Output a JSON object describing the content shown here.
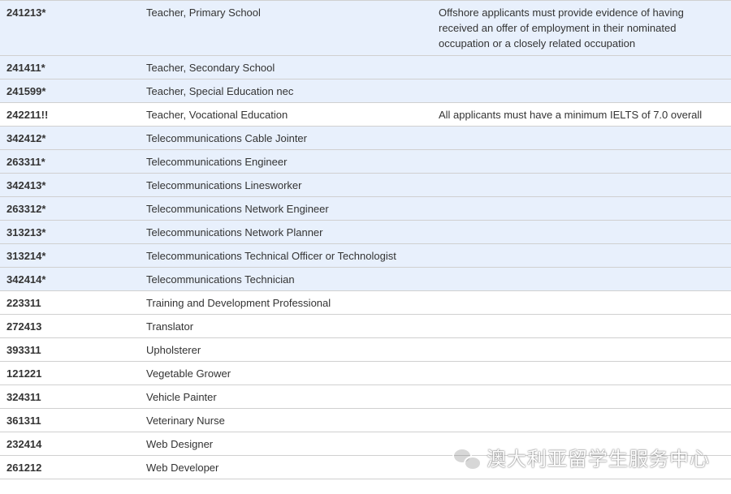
{
  "rows": [
    {
      "code": "241213*",
      "name": "Teacher, Primary School",
      "condition": "Offshore applicants must  provide evidence of having received an offer of employment in their nominated occupation or a closely related occupation",
      "shade": "blue"
    },
    {
      "code": "241411*",
      "name": "Teacher, Secondary School",
      "condition": "",
      "shade": "blue"
    },
    {
      "code": "241599*",
      "name": "Teacher, Special Education nec",
      "condition": "",
      "shade": "blue"
    },
    {
      "code": "242211!!",
      "name": "Teacher, Vocational Education",
      "condition": "All applicants must have a minimum IELTS of 7.0 overall",
      "shade": "white"
    },
    {
      "code": "342412*",
      "name": "Telecommunications Cable Jointer",
      "condition": "",
      "shade": "blue"
    },
    {
      "code": "263311*",
      "name": "Telecommunications Engineer",
      "condition": "",
      "shade": "blue"
    },
    {
      "code": "342413*",
      "name": "Telecommunications Linesworker",
      "condition": "",
      "shade": "blue"
    },
    {
      "code": "263312*",
      "name": "Telecommunications Network Engineer",
      "condition": "",
      "shade": "blue"
    },
    {
      "code": "313213*",
      "name": "Telecommunications Network Planner",
      "condition": "",
      "shade": "blue"
    },
    {
      "code": "313214*",
      "name": "Telecommunications Technical Officer or Technologist",
      "condition": "",
      "shade": "blue"
    },
    {
      "code": "342414*",
      "name": "Telecommunications Technician",
      "condition": "",
      "shade": "blue"
    },
    {
      "code": "223311",
      "name": "Training and Development Professional",
      "condition": "",
      "shade": "white"
    },
    {
      "code": "272413",
      "name": "Translator",
      "condition": "",
      "shade": "white"
    },
    {
      "code": "393311",
      "name": "Upholsterer",
      "condition": "",
      "shade": "white"
    },
    {
      "code": "121221",
      "name": "Vegetable Grower",
      "condition": "",
      "shade": "white"
    },
    {
      "code": "324311",
      "name": "Vehicle Painter",
      "condition": "",
      "shade": "white"
    },
    {
      "code": "361311",
      "name": "Veterinary Nurse",
      "condition": "",
      "shade": "white"
    },
    {
      "code": "232414",
      "name": "Web Designer",
      "condition": "",
      "shade": "white"
    },
    {
      "code": "261212",
      "name": "Web Developer",
      "condition": "",
      "shade": "white"
    }
  ],
  "watermark": {
    "text": "澳大利亚留学生服务中心",
    "icon": "wechat-icon"
  },
  "colors": {
    "highlight_row": "#e8f0fc",
    "row_border": "#d0d0d0",
    "text": "#333333"
  }
}
